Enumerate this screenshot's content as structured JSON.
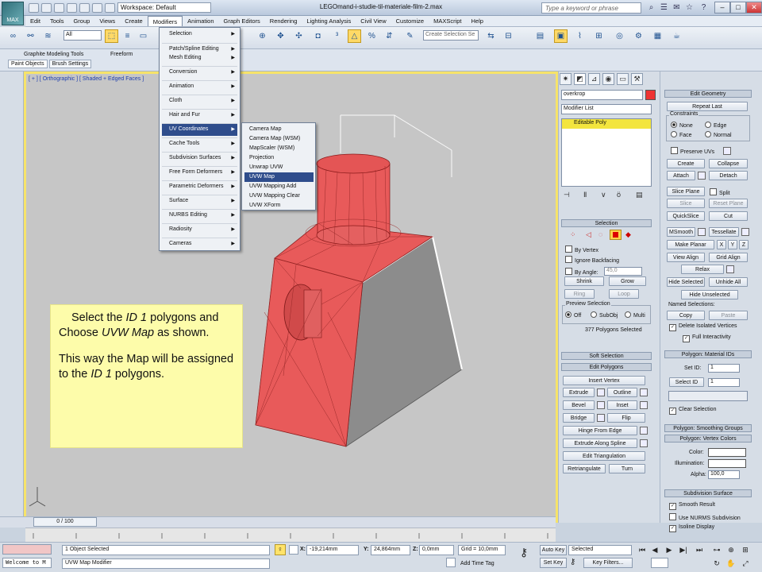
{
  "app": {
    "title": "LEGOmand-i-studie-til-materiale-film-2.max",
    "workspace": "Workspace: Default",
    "help_search_placeholder": "Type a keyword or phrase",
    "logo_text": "MAX"
  },
  "menubar": [
    "Edit",
    "Tools",
    "Group",
    "Views",
    "Create",
    "Modifiers",
    "Animation",
    "Graph Editors",
    "Rendering",
    "Lighting Analysis",
    "Civil View",
    "Customize",
    "MAXScript",
    "Help"
  ],
  "toolbar": {
    "filter": "All",
    "selection_set_placeholder": "Create Selection Se"
  },
  "ribbon": {
    "tabs": [
      "Graphite Modeling Tools",
      "Freeform"
    ],
    "subtabs": [
      "Paint Objects",
      "Brush Settings"
    ]
  },
  "viewport": {
    "label": "[ + ] [ Orthographic ] [ Shaded + Edged Faces ]"
  },
  "modifiers_menu": {
    "items": [
      {
        "label": "Selection"
      },
      {
        "label": "Patch/Spline Editing"
      },
      {
        "label": "Mesh Editing"
      },
      {
        "label": "Conversion"
      },
      {
        "label": "Animation"
      },
      {
        "label": "Cloth"
      },
      {
        "label": "Hair and Fur"
      },
      {
        "label": "UV Coordinates"
      },
      {
        "label": "Cache Tools"
      },
      {
        "label": "Subdivision Surfaces"
      },
      {
        "label": "Free Form Deformers"
      },
      {
        "label": "Parametric Deformers"
      },
      {
        "label": "Surface"
      },
      {
        "label": "NURBS Editing"
      },
      {
        "label": "Radiosity"
      },
      {
        "label": "Cameras"
      }
    ]
  },
  "uv_menu": {
    "items": [
      {
        "label": "Camera Map"
      },
      {
        "label": "Camera Map (WSM)"
      },
      {
        "label": "MapScaler (WSM)"
      },
      {
        "label": "Projection"
      },
      {
        "label": "Unwrap UVW"
      },
      {
        "label": "UVW Map"
      },
      {
        "label": "UVW Mapping Add"
      },
      {
        "label": "UVW Mapping Clear"
      },
      {
        "label": "UVW XForm"
      }
    ]
  },
  "note": {
    "l1a": "Select the ",
    "l1b": "ID 1",
    "l1c": " polygons and Choose ",
    "l1d": "UVW Map",
    "l1e": " as shown.",
    "l2a": "This way the Map will be assigned to the ",
    "l2b": "ID 1",
    "l2c": " polygons."
  },
  "command_panel": {
    "object_name": "overkrop",
    "modifier_list": "Modifier List",
    "stack_item": "Editable Poly",
    "selection": {
      "title": "Selection",
      "by_vertex": "By Vertex",
      "ignore_backfacing": "Ignore Backfacing",
      "by_angle": "By Angle:",
      "angle": "45,0",
      "shrink": "Shrink",
      "grow": "Grow",
      "ring": "Ring",
      "loop": "Loop",
      "preview_title": "Preview Selection",
      "off": "Off",
      "subobj": "SubObj",
      "multi": "Multi",
      "status": "377 Polygons Selected"
    },
    "soft_selection": "Soft Selection",
    "edit_polygons": {
      "title": "Edit Polygons",
      "insert_vertex": "Insert Vertex",
      "extrude": "Extrude",
      "outline": "Outline",
      "bevel": "Bevel",
      "inset": "Inset",
      "bridge": "Bridge",
      "flip": "Flip",
      "hinge": "Hinge From Edge",
      "extrude_spline": "Extrude Along Spline",
      "edit_triangulation": "Edit Triangulation",
      "retriangulate": "Retriangulate",
      "turn": "Turn"
    },
    "edit_geometry": {
      "title": "Edit Geometry",
      "repeat_last": "Repeat Last",
      "constraints": "Constraints",
      "none": "None",
      "edge": "Edge",
      "face": "Face",
      "normal": "Normal",
      "preserve_uvs": "Preserve UVs",
      "create": "Create",
      "collapse": "Collapse",
      "attach": "Attach",
      "detach": "Detach",
      "slice_plane": "Slice Plane",
      "split": "Split",
      "slice": "Slice",
      "reset_plane": "Reset Plane",
      "quickslice": "QuickSlice",
      "cut": "Cut",
      "msmooth": "MSmooth",
      "tessellate": "Tessellate",
      "make_planar": "Make Planar",
      "x": "X",
      "y": "Y",
      "z": "Z",
      "view_align": "View Align",
      "grid_align": "Grid Align",
      "relax": "Relax",
      "hide_selected": "Hide Selected",
      "unhide_all": "Unhide All",
      "hide_unselected": "Hide Unselected",
      "named_selections": "Named Selections:",
      "copy": "Copy",
      "paste": "Paste",
      "delete_isolated": "Delete Isolated Vertices",
      "full_interactivity": "Full Interactivity"
    },
    "material_ids": {
      "title": "Polygon: Material IDs",
      "set_id": "Set ID:",
      "set_id_value": "1",
      "select_id": "Select ID",
      "select_id_value": "1",
      "clear_selection": "Clear Selection"
    },
    "smoothing_groups": "Polygon: Smoothing Groups",
    "vertex_colors": {
      "title": "Polygon: Vertex Colors",
      "color": "Color:",
      "illumination": "Illumination:",
      "alpha": "Alpha:",
      "alpha_value": "100,0"
    },
    "subdivision": {
      "title": "Subdivision Surface",
      "smooth_result": "Smooth Result",
      "use_nurms": "Use NURMS Subdivision",
      "isoline": "Isoline Display"
    }
  },
  "status": {
    "time": "0 / 100",
    "objects_selected": "1 Object Selected",
    "prompt": "UVW Map Modifier",
    "welcome": "Welcome to M",
    "x_label": "X:",
    "x": "-19,214mm",
    "y_label": "Y:",
    "y": "24,864mm",
    "z_label": "Z:",
    "z": "0,0mm",
    "grid": "Grid = 10,0mm",
    "add_time_tag": "Add Time Tag",
    "auto_key": "Auto Key",
    "selected": "Selected",
    "set_key": "Set Key",
    "key_filters": "Key Filters..."
  },
  "colors": {
    "viewport_border": "#f6e36a",
    "object_red": "#e85a5a",
    "menu_highlight": "#2f4d8c",
    "note_bg": "#fdfcaa"
  }
}
